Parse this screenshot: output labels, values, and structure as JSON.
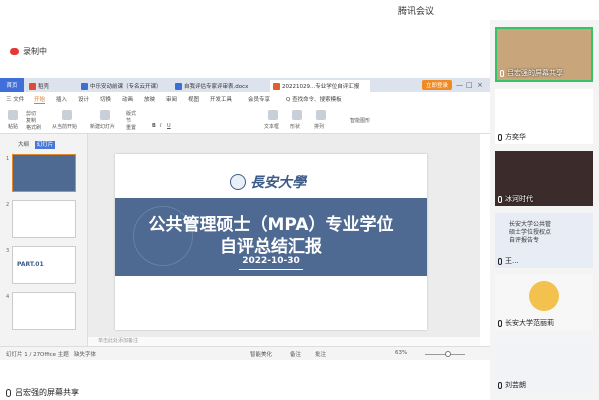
{
  "meeting": {
    "title": "腾讯会议",
    "recording_label": "录制中",
    "presenter": "吕宏强的屏幕共享"
  },
  "colors": {
    "accent": "#3f6fd8",
    "wps_orange": "#d9822b",
    "slide_band": "#4e6a92",
    "speaker_border": "#35c36a",
    "record_red": "#e53935"
  },
  "wps": {
    "tabs": [
      {
        "label": "首页",
        "icon": "home-icon"
      },
      {
        "label": "稻壳",
        "icon": "daoke-icon"
      },
      {
        "label": "中乐安动前课（专名云开课）",
        "icon": "word-icon"
      },
      {
        "label": "自我评估专家评审表.docx",
        "icon": "word-icon"
      },
      {
        "label": "20221029...专业学位自评汇报",
        "icon": "ppt-icon"
      }
    ],
    "login_label": "立即登录",
    "menu": [
      "三 文件",
      "开始",
      "插入",
      "设计",
      "切换",
      "动画",
      "放映",
      "审阅",
      "视图",
      "开发工具",
      "会员专享",
      "Q 查找命令、搜索模板"
    ],
    "active_menu": "开始",
    "toolbar": {
      "paste": "粘贴",
      "clip": "剪切",
      "copy": "复制",
      "format": "格式刷",
      "from_current": "从当前开始",
      "new_slide": "新建幻灯片",
      "layout": "版式",
      "section": "节",
      "reset": "重置",
      "bold": "B",
      "italic": "I",
      "underline": "U",
      "textbox": "文本框",
      "shape": "形状",
      "arrange": "排列",
      "smart_graph": "智能图形"
    },
    "panel_tabs": [
      "大纲",
      "幻灯片"
    ],
    "thumb_numbers": [
      "1",
      "2",
      "3",
      "4"
    ],
    "thumb3_text": "PART.01",
    "notes_placeholder": "单击此处添加备注",
    "status": {
      "slide_info": "幻灯片 1 / 27",
      "theme": "Office 主题",
      "missing_font": "缺失字体",
      "smart_beautify": "智能美化",
      "notes": "备注",
      "comments": "批注",
      "zoom": "63%"
    }
  },
  "slide": {
    "logo_text": "長安大學",
    "title_line1": "公共管理硕士（MPA）专业学位",
    "title_line2": "自评总结汇报",
    "date": "2022-10-30"
  },
  "participants": [
    {
      "name": "吕宏强的屏幕共享",
      "bg": "#c8a57a"
    },
    {
      "name": "方奕华",
      "bg": "#ffffff"
    },
    {
      "name": "冰河时代",
      "bg": "#3b2b2a"
    },
    {
      "name": "王...",
      "bg": "#e8ecf4"
    },
    {
      "name": "长安大学范丽莉",
      "bg": "#f7f7f7"
    },
    {
      "name": "刘芸朗",
      "bg": "#f1f3f7"
    }
  ],
  "participant_slide_text": [
    "长安大学公共管",
    "硕士学位授权点",
    "自评报告专"
  ]
}
